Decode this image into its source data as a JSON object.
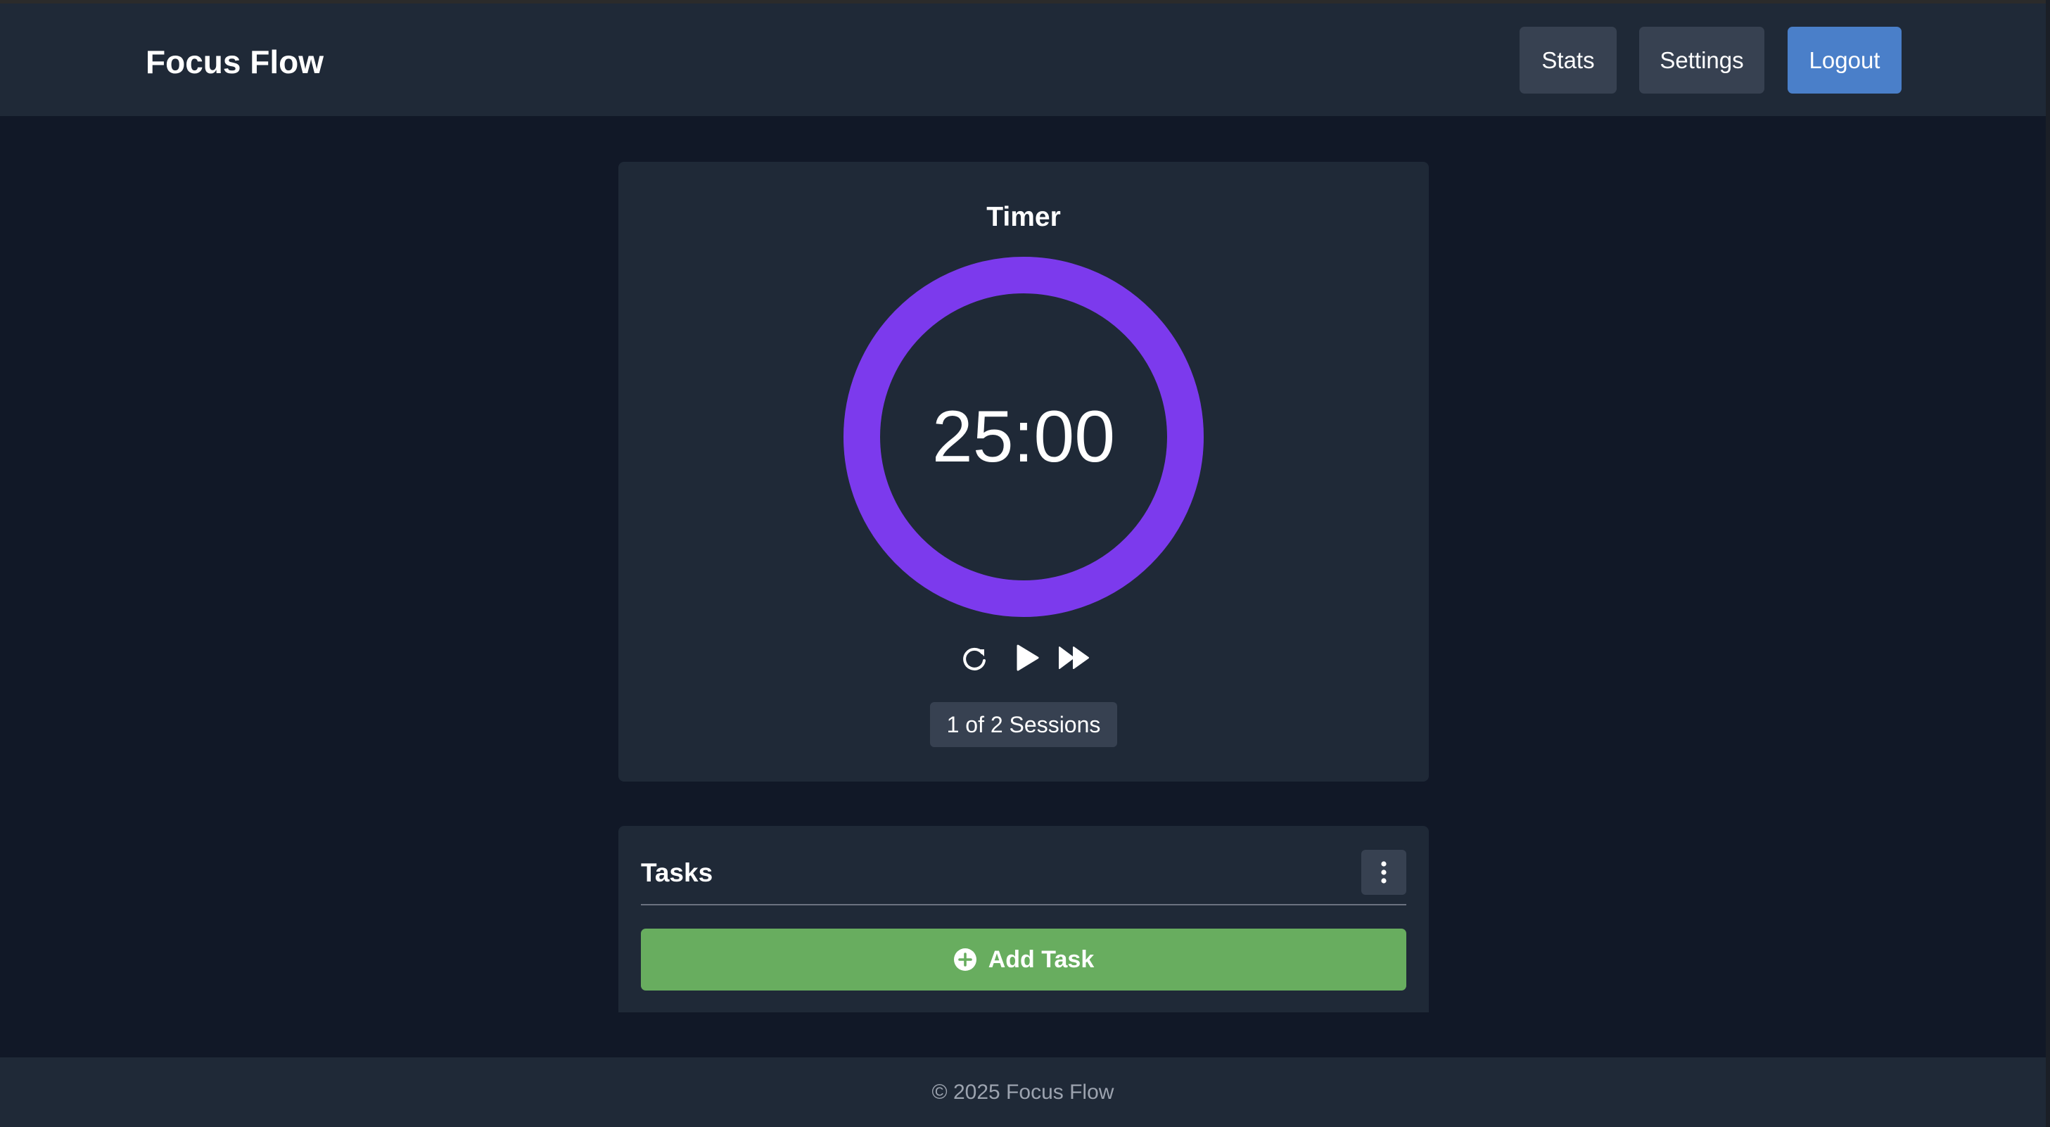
{
  "header": {
    "brand": "Focus Flow",
    "nav": {
      "stats_label": "Stats",
      "settings_label": "Settings",
      "logout_label": "Logout"
    }
  },
  "timer": {
    "title": "Timer",
    "time": "25:00",
    "progress": 1.0,
    "sessions": "1 of 2 Sessions",
    "controls": {
      "reset_icon": "reset-icon",
      "play_icon": "play-icon",
      "skip_icon": "skip-icon"
    }
  },
  "tasks": {
    "title": "Tasks",
    "menu_icon": "kebab-menu-icon",
    "add_label": "Add Task",
    "add_icon": "plus-circle-icon"
  },
  "footer": {
    "text": "© 2025 Focus Flow"
  },
  "colors": {
    "background": "#111827",
    "surface": "#1f2937",
    "button_secondary": "#374151",
    "accent_blue": "#4a7fc9",
    "ring_purple": "#7c3aed",
    "success_green": "#68ad5f",
    "muted_text": "#9ca3af"
  }
}
